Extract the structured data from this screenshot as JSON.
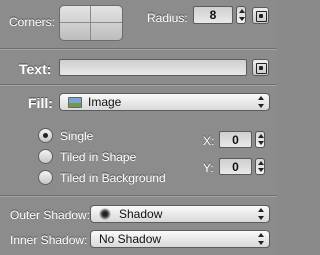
{
  "corners": {
    "label": "Corners:"
  },
  "radius": {
    "label": "Radius:",
    "value": "8"
  },
  "text": {
    "label": "Text:",
    "value": ""
  },
  "fill": {
    "label": "Fill:",
    "selected": "Image",
    "options": [
      {
        "label": "Single",
        "selected": true
      },
      {
        "label": "Tiled in Shape",
        "selected": false
      },
      {
        "label": "Tiled in Background",
        "selected": false
      }
    ],
    "x_label": "X:",
    "x_value": "0",
    "y_label": "Y:",
    "y_value": "0"
  },
  "outer_shadow": {
    "label": "Outer Shadow:",
    "selected": "Shadow"
  },
  "inner_shadow": {
    "label": "Inner Shadow:",
    "selected": "No Shadow"
  },
  "icons": {
    "variable": "variable-binding-icon",
    "image": "image-icon",
    "shadow": "shadow-icon"
  }
}
